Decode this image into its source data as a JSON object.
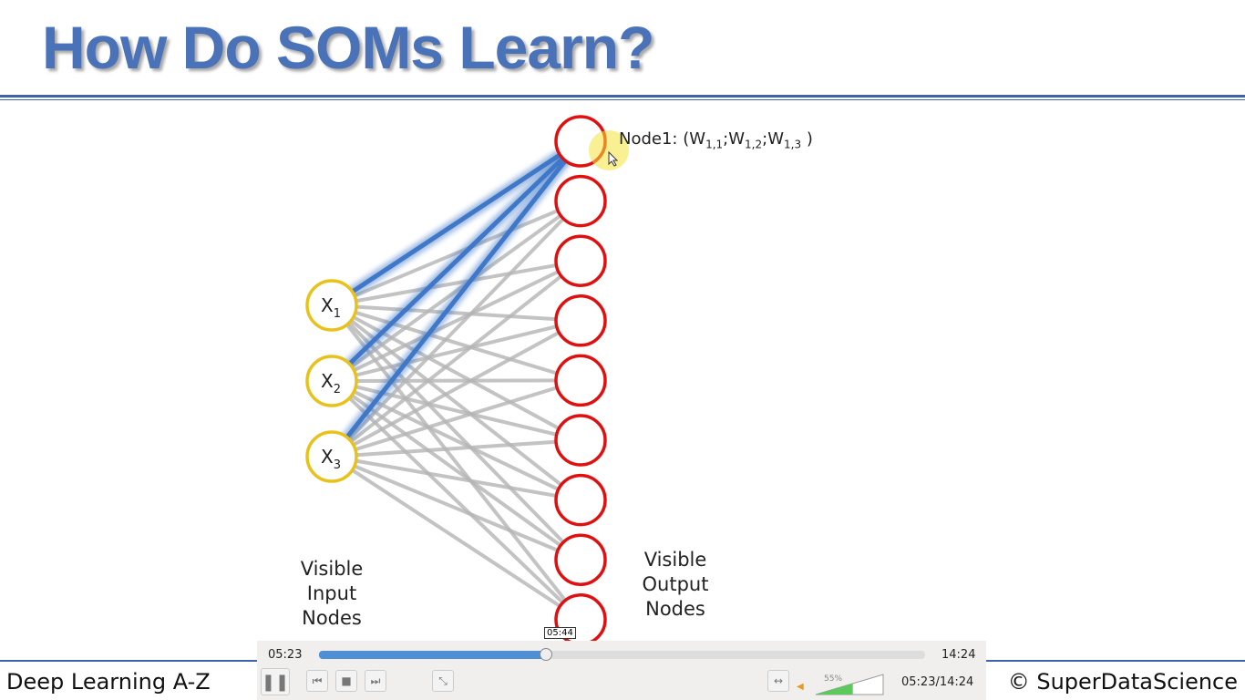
{
  "slide": {
    "title": "How Do SOMs Learn?",
    "node1_label": "Node1: (",
    "weights": [
      "W",
      "1,1",
      ";W",
      "1,2",
      ";W",
      "1,3",
      " )"
    ],
    "inputs": [
      {
        "label": "X",
        "sub": "1"
      },
      {
        "label": "X",
        "sub": "2"
      },
      {
        "label": "X",
        "sub": "3"
      }
    ],
    "output_count": 9,
    "input_caption": [
      "Visible",
      "Input",
      "Nodes"
    ],
    "output_caption": [
      "Visible",
      "Output",
      "Nodes"
    ],
    "footer_left": "Deep Learning A-Z",
    "footer_right": "© SuperDataScience"
  },
  "colors": {
    "title": "#4a72b8",
    "input_stroke": "#e8c21a",
    "output_stroke": "#e01010",
    "active_line": "#3f78c8",
    "line": "#b5b5b5"
  },
  "player": {
    "elapsed": "05:23",
    "duration": "14:24",
    "hover_time": "05:44",
    "progress": 0.374,
    "volume_label": "55%",
    "volume": 0.55,
    "time_display": "05:23/14:24"
  }
}
